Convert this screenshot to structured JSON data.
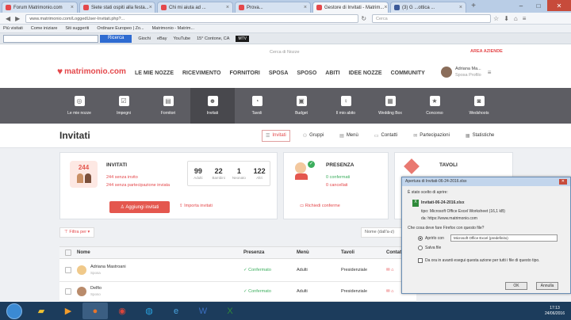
{
  "browser": {
    "tabs": [
      {
        "label": "Forum Matrimonio.com",
        "active": false
      },
      {
        "label": "Siete stati ospiti alla festa...",
        "active": false
      },
      {
        "label": "Chi mi aiuta ad ...",
        "active": false
      },
      {
        "label": "Prova...",
        "active": false
      },
      {
        "label": "Gestore di Invitati - Matrim...",
        "active": true
      },
      {
        "label": "(3) G ...ottica ...",
        "active": false
      }
    ],
    "url": "www.matrimonio.com/LoggedUser-Invitati.php?...",
    "search_placeholder": "Cerca",
    "bookmarks": [
      "Più visitati",
      "Come iniziare",
      "Siti suggeriti",
      "Ordinare Europeo | Zo...",
      "Matrimonio - Matrim..."
    ],
    "toolbar": {
      "search_button": "Ricerca",
      "weather": "15° Contone, CA",
      "items": [
        "Giochi",
        "eBay",
        "YouTube",
        "MTV"
      ]
    }
  },
  "site": {
    "logo": "matrimonio.com",
    "find_suppliers": "Cerca di Nozze",
    "access": "AREA AZIENDE",
    "main_nav": [
      "LE MIE NOZZE",
      "RICEVIMENTO",
      "FORNITORI",
      "SPOSA",
      "SPOSO",
      "ABITI",
      "IDEE NOZZE",
      "COMMUNITY"
    ],
    "user": {
      "name": "Adriana Ma...",
      "sub": "Sposa Profilo"
    },
    "sub_nav": [
      {
        "label": "Le mie nozze",
        "icon": "rings-icon",
        "active": false
      },
      {
        "label": "Impegni",
        "icon": "checklist-icon",
        "active": false
      },
      {
        "label": "Fornitori",
        "icon": "suppliers-icon",
        "active": false
      },
      {
        "label": "Invitati",
        "icon": "guests-icon",
        "active": true
      },
      {
        "label": "Tavoli",
        "icon": "tables-icon",
        "active": false
      },
      {
        "label": "Budget",
        "icon": "budget-icon",
        "active": false
      },
      {
        "label": "Il mio abito",
        "icon": "dress-icon",
        "active": false
      },
      {
        "label": "Wedding Box",
        "icon": "box-icon",
        "active": false
      },
      {
        "label": "Concorso",
        "icon": "contest-icon",
        "active": false
      },
      {
        "label": "Wedshoots",
        "icon": "camera-icon",
        "active": false
      }
    ],
    "page_title": "Invitati",
    "section_tabs": [
      "Invitati",
      "Gruppi",
      "Menù",
      "Contatti",
      "Partecipazioni",
      "Statistiche"
    ]
  },
  "cards": {
    "invitati": {
      "title": "INVITATI",
      "big_number": "244",
      "line1": "244 senza invito",
      "line2": "244 senza partecipazione inviata",
      "stats": [
        {
          "value": "99",
          "label": "Adulti"
        },
        {
          "value": "22",
          "label": "Bambini"
        },
        {
          "value": "1",
          "label": "Neonato"
        },
        {
          "value": "122",
          "label": "Altri"
        }
      ],
      "button": "Aggiungi invitati",
      "import": "Importa invitati"
    },
    "presenza": {
      "title": "PRESENZA",
      "line1": "0 confermati",
      "line2": "0 cancellati",
      "link": "Richiedi conferme"
    },
    "tavoli": {
      "title": "TAVOLI"
    }
  },
  "table": {
    "filter_label": "Filtra per",
    "sort_label": "Nome (dall'a-z)",
    "columns": [
      "Nome",
      "Presenza",
      "Menù",
      "Tavoli",
      "Contatti"
    ],
    "rows": [
      {
        "name": "Adriana Mastroani",
        "role": "Sposa",
        "presence": "Confermato",
        "menu": "Adulti",
        "table": "Presidenziale"
      },
      {
        "name": "Delfio",
        "role": "Sposo",
        "presence": "Confermato",
        "menu": "Adulti",
        "table": "Presidenziale"
      }
    ]
  },
  "dialog": {
    "title": "Apertura di Invitati-06-24-2016.xlsx",
    "heading": "È stato scelto di aprire:",
    "filename": "Invitati-06-24-2016.xlsx",
    "type": "tipo: Microsoft Office Excel Worksheet (16,1 kB)",
    "from": "da: https://www.matrimonio.com",
    "question": "Che cosa deve fare Firefox con questo file?",
    "open_with_label": "Aprirlo con",
    "open_with_value": "Microsoft Office Excel (predefinito)",
    "save_label": "Salva file",
    "remember_label": "Da ora in avanti esegui questa azione per tutti i file di questo tipo.",
    "ok": "OK",
    "cancel": "Annulla"
  },
  "taskbar": {
    "time": "17:13",
    "date": "24/06/2016"
  }
}
